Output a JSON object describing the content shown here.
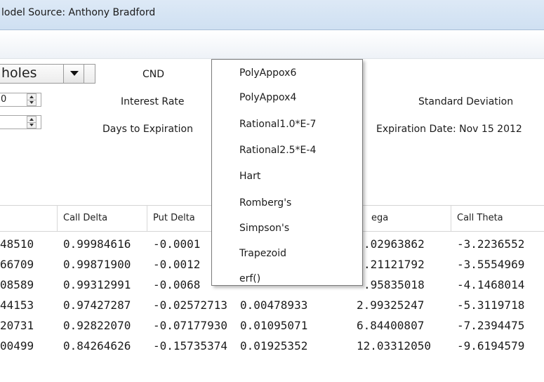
{
  "window": {
    "title": "lodel Source: Anthony Bradford"
  },
  "controls": {
    "model_combo": {
      "value": "holes"
    },
    "spinner_1": {
      "value": "0"
    },
    "spinner_2": {
      "value": ""
    },
    "cnd_label": "CND",
    "interest_rate_label": "Interest Rate",
    "days_to_expiration_label": "Days to Expiration",
    "standard_deviation_label": "Standard Deviation",
    "expiration_date_label": "Expiration Date: Nov 15 2012"
  },
  "cnd_dropdown": {
    "options": [
      "PolyAppox6",
      "PolyAppox4",
      "Rational1.0*E-7",
      "Rational2.5*E-4",
      "Hart",
      "Romberg's",
      "Simpson's",
      "Trapezoid",
      "erf()"
    ]
  },
  "table": {
    "columns": [
      "",
      "Call Delta",
      "Put Delta",
      "",
      "ega",
      "Call Theta"
    ],
    "rows": [
      [
        "48510",
        "0.99984616",
        "-0.0001",
        "",
        ".02963862",
        "-3.2236552"
      ],
      [
        "66709",
        "0.99871900",
        "-0.0012",
        "",
        ".21121792",
        "-3.5554969"
      ],
      [
        "08589",
        "0.99312991",
        "-0.0068",
        "",
        ".95835018",
        "-4.1468014"
      ],
      [
        "44153",
        "0.97427287",
        "-0.02572713",
        "0.00478933",
        "2.99325247",
        "-5.3119718"
      ],
      [
        "20731",
        "0.92822070",
        "-0.07177930",
        "0.01095071",
        "6.84400807",
        "-7.2394475"
      ],
      [
        "00499",
        "0.84264626",
        "-0.15735374",
        "0.01925352",
        "12.03312050",
        "-9.6194579"
      ]
    ]
  }
}
